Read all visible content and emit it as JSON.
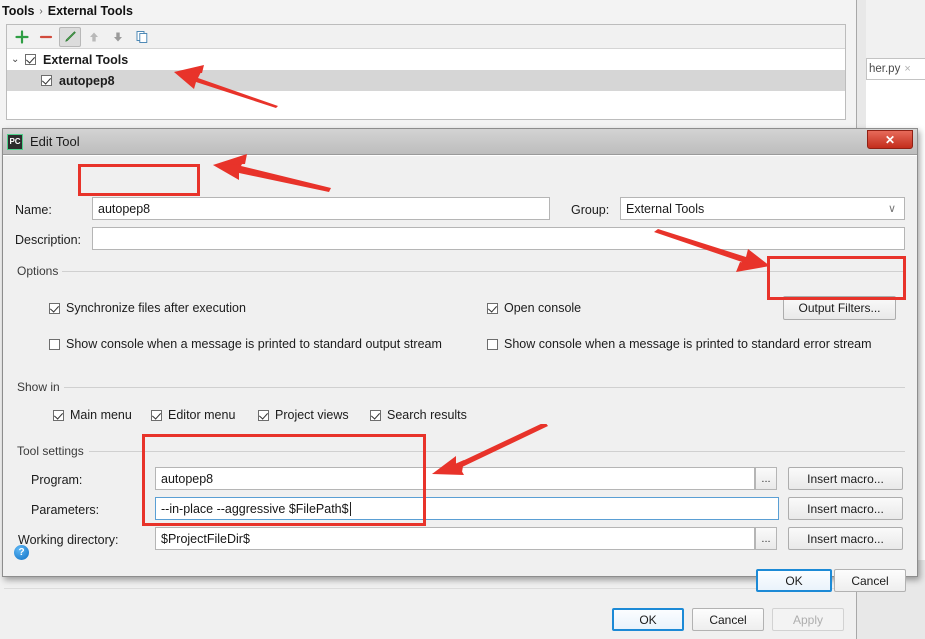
{
  "breadcrumb": {
    "root": "Tools",
    "sep": "›",
    "leaf": "External Tools"
  },
  "toolbar": {
    "add": "add-icon",
    "remove": "remove-icon",
    "edit": "edit-pencil-icon",
    "move_up": "arrow-up-icon",
    "move_down": "arrow-down-icon",
    "copy": "copy-icon"
  },
  "tree": {
    "group": {
      "label": "External Tools",
      "checked": true,
      "expanded": true
    },
    "items": [
      {
        "label": "autopep8",
        "checked": true,
        "selected": true
      }
    ]
  },
  "editor_tab": {
    "label": "her.py",
    "close": "×"
  },
  "settings_window": {
    "buttons": [
      {
        "label": "OK",
        "style": "default"
      },
      {
        "label": "Cancel",
        "style": "normal"
      },
      {
        "label": "Apply",
        "style": "disabled"
      }
    ]
  },
  "dialog": {
    "title": "Edit Tool",
    "app_icon": "PC",
    "close_label": "✕",
    "name": {
      "label": "Name:",
      "value": "autopep8"
    },
    "group": {
      "label": "Group:",
      "value": "External Tools",
      "chevron": "∨"
    },
    "description": {
      "label": "Description:",
      "value": ""
    },
    "options": {
      "title": "Options",
      "checkboxes": [
        {
          "label": "Synchronize files after execution",
          "checked": true
        },
        {
          "label": "Open console",
          "checked": true
        },
        {
          "label": "Show console when a message is printed to standard output stream",
          "checked": false
        },
        {
          "label": "Show console when a message is printed to standard error stream",
          "checked": false
        }
      ],
      "output_filters_button": "Output Filters..."
    },
    "show_in": {
      "title": "Show in",
      "checkboxes": [
        {
          "label": "Main menu",
          "checked": true
        },
        {
          "label": "Editor menu",
          "checked": true
        },
        {
          "label": "Project views",
          "checked": true
        },
        {
          "label": "Search results",
          "checked": true
        }
      ]
    },
    "tool_settings": {
      "title": "Tool settings",
      "rows": [
        {
          "label": "Program:",
          "value": "autopep8",
          "browse": "...",
          "macro": "Insert macro...",
          "focused": false
        },
        {
          "label": "Parameters:",
          "value": "--in-place --aggressive  $FilePath$",
          "browse": "",
          "macro": "Insert macro...",
          "focused": true
        },
        {
          "label": "Working directory:",
          "value": "$ProjectFileDir$",
          "browse": "...",
          "macro": "Insert macro...",
          "focused": false
        }
      ]
    },
    "help_icon": "?",
    "buttons": [
      {
        "label": "OK",
        "style": "default"
      },
      {
        "label": "Cancel",
        "style": "normal"
      }
    ]
  },
  "annotations": {
    "accent_color": "#e8332a",
    "highlights": [
      "name-field",
      "output-filters-button",
      "tool-settings-fields"
    ]
  }
}
